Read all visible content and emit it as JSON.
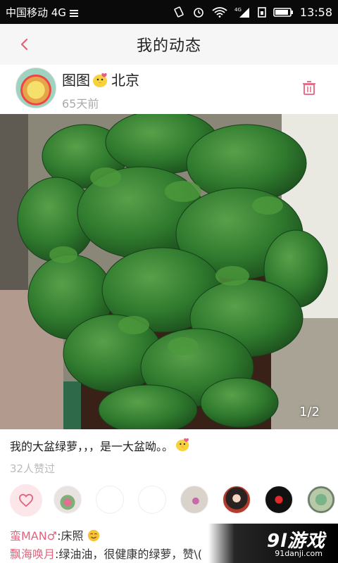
{
  "status_bar": {
    "carrier": "中国移动 4G",
    "network_badge": "4G",
    "time": "13:58"
  },
  "header": {
    "title": "我的动态",
    "accent_color": "#e2637d"
  },
  "post": {
    "username": "图图",
    "location": "北京",
    "time_ago": "65天前",
    "photo_counter": "1/2",
    "caption": "我的大盆绿萝，，，是一大盆呦。。",
    "likes_text": "32人赞过"
  },
  "comments": [
    {
      "name": "蛮MAN♂",
      "text": ":床照"
    },
    {
      "name": "飘海唤月",
      "text": ":绿油油，很健康的绿萝，赞\\("
    }
  ],
  "watermark": {
    "logo": "9l游戏",
    "url": "91danji.com"
  }
}
